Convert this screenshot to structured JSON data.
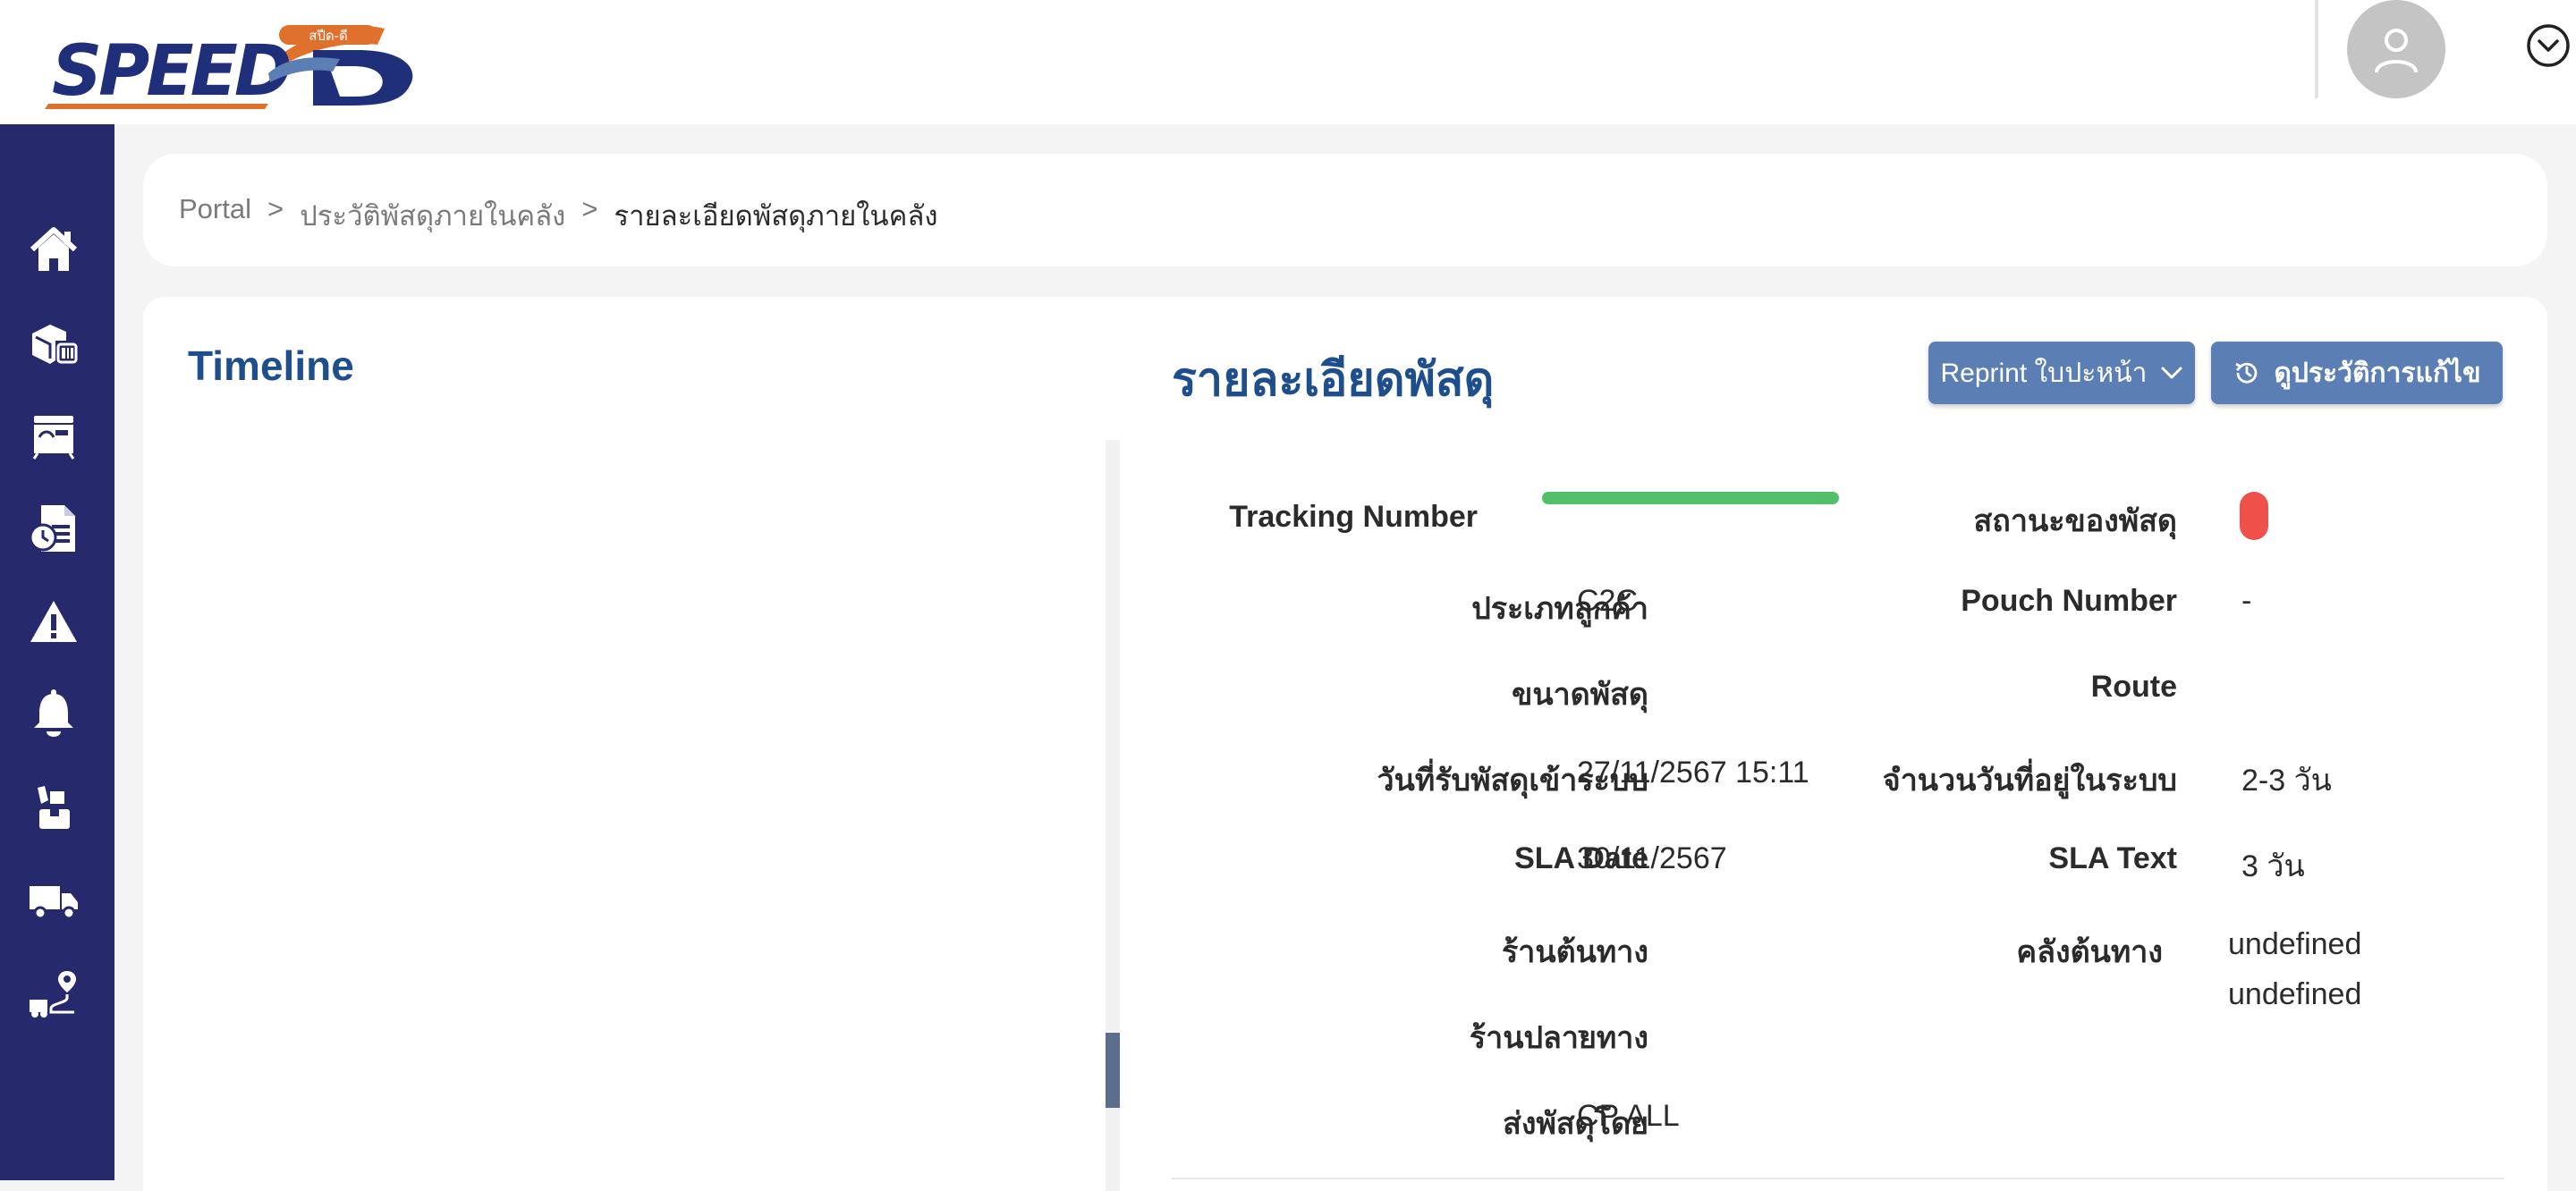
{
  "app": {
    "logo_text": "SPEED D",
    "logo_badge": "สปีด-ดี"
  },
  "colors": {
    "sidebar": "#262a6c",
    "primary_title": "#1f4e8c",
    "button": "#5b7eb5",
    "tracking_bar": "#52c06a",
    "status_pill": "#f0504a"
  },
  "header": {
    "avatar_icon": "user-icon",
    "menu_icon": "chevron-down-circle-icon"
  },
  "sidebar": {
    "items": [
      {
        "icon": "home-icon"
      },
      {
        "icon": "package-scan-icon"
      },
      {
        "icon": "store-icon"
      },
      {
        "icon": "document-clock-icon"
      },
      {
        "icon": "warning-icon"
      },
      {
        "icon": "bell-icon"
      },
      {
        "icon": "hand-package-icon"
      },
      {
        "icon": "delivery-truck-icon"
      },
      {
        "icon": "route-truck-icon"
      }
    ]
  },
  "breadcrumb": {
    "items": [
      "Portal",
      "ประวัติพัสดุภายในคลัง",
      "รายละเอียดพัสดุภายในคลัง"
    ],
    "separator": ">"
  },
  "timeline": {
    "title": "Timeline"
  },
  "detail": {
    "title": "รายละเอียดพัสดุ",
    "reprint_label": "Reprint ใบปะหน้า",
    "history_label": "ดูประวัติการแก้ไข",
    "fields": {
      "tracking_label": "Tracking Number",
      "status_label": "สถานะของพัสดุ",
      "customer_type_label": "ประเภทลูกค้า",
      "customer_type_value": "C2C",
      "pouch_label": "Pouch Number",
      "pouch_value": "-",
      "size_label": "ขนาดพัสดุ",
      "route_label": "Route",
      "received_label": "วันที่รับพัสดุเข้าระบบ",
      "received_value": "27/11/2567 15:11",
      "days_label": "จำนวนวันที่อยู่ในระบบ",
      "days_value": "2-3 วัน",
      "sla_date_label": "SLA Date",
      "sla_date_value": "30/11/2567",
      "sla_text_label": "SLA Text",
      "sla_text_value": "3 วัน",
      "origin_shop_label": "ร้านต้นทาง",
      "origin_wh_label": "คลังต้นทาง",
      "origin_wh_value_1": "undefined",
      "origin_wh_value_2": "undefined",
      "dest_shop_label": "ร้านปลายทาง",
      "dest_shop_value": "-",
      "sender_label": "ส่งพัสดุโดย",
      "sender_value": "CP ALL"
    }
  }
}
